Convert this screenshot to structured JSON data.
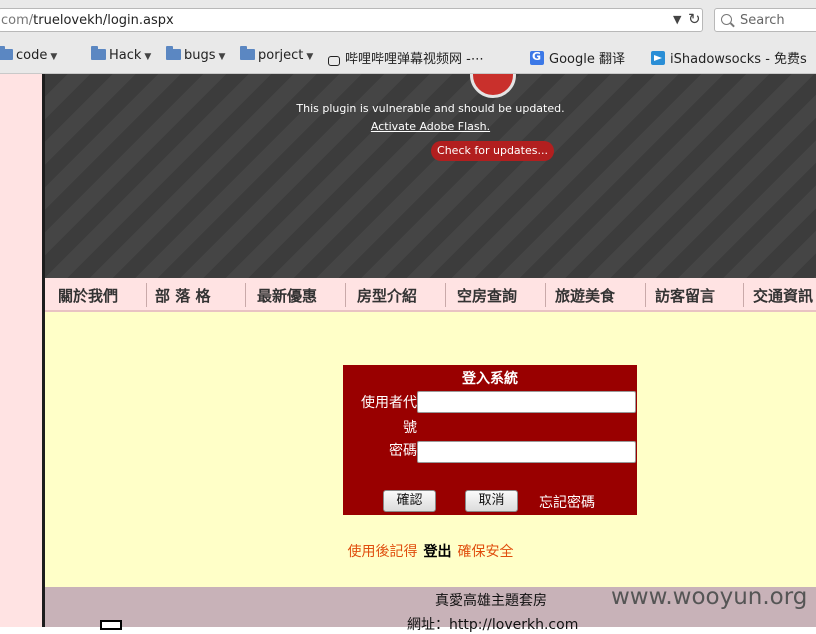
{
  "browser": {
    "url_host": "com/",
    "url_path": "truelovekh/login.aspx",
    "search_placeholder": "Search",
    "bookmarks": [
      {
        "label": "code"
      },
      {
        "label": "Hack"
      },
      {
        "label": "bugs"
      },
      {
        "label": "porject"
      },
      {
        "label": "哔哩哔哩弹幕视频网 -⋯"
      },
      {
        "label": "Google 翻译"
      },
      {
        "label": "iShadowsocks - 免费s"
      }
    ]
  },
  "flash": {
    "message": "This plugin is vulnerable and should be updated.",
    "activate_link": "Activate Adobe Flash.",
    "update_button": "Check for updates..."
  },
  "nav": {
    "items": [
      "關於我們",
      "部 落 格",
      "最新優惠",
      "房型介紹",
      "空房查詢",
      "旅遊美食",
      "訪客留言",
      "交通資訊"
    ]
  },
  "login": {
    "title": "登入系統",
    "username_label": "使用者代號",
    "username_value": "",
    "password_label": "密碼",
    "password_value": "",
    "ok_button": "確認",
    "cancel_button": "取消",
    "forgot_link": "忘記密碼"
  },
  "bottom": {
    "left": "使用後記得",
    "middle": "登出",
    "right": "確保安全"
  },
  "footer": {
    "title": "真愛高雄主題套房",
    "address": "網址：http://loverkh.com"
  },
  "watermark": "www.wooyun.org",
  "colors": {
    "login_bg": "#990000",
    "content_bg": "#ffffc8",
    "nav_bg": "#ffe3e3",
    "warning_orange": "#e04e0e"
  }
}
